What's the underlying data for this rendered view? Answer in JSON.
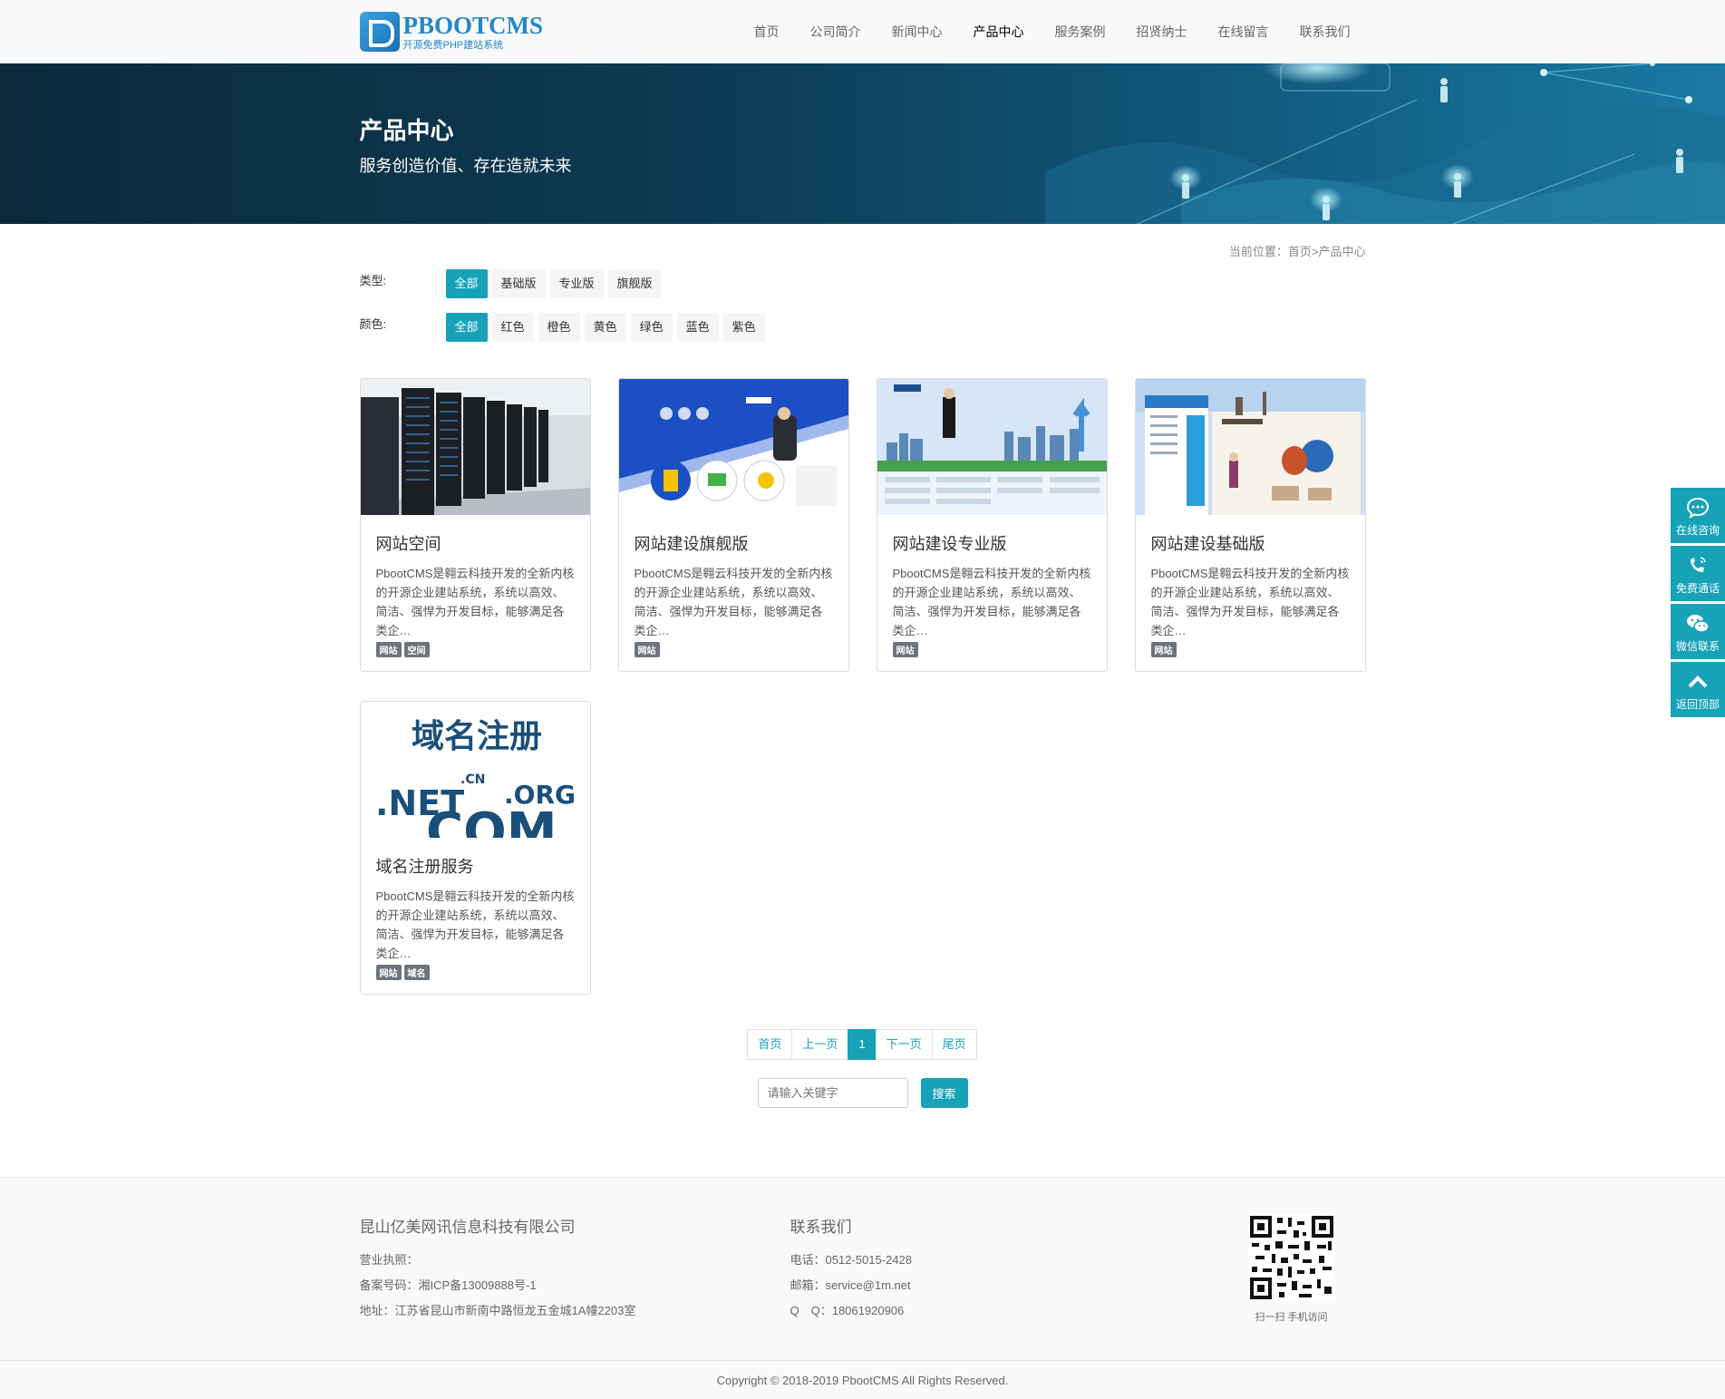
{
  "header": {
    "logo_name": "PBOOTCMS",
    "logo_sub": "开源免费PHP建站系统",
    "nav": [
      "首页",
      "公司简介",
      "新闻中心",
      "产品中心",
      "服务案例",
      "招贤纳士",
      "在线留言",
      "联系我们"
    ]
  },
  "banner": {
    "title": "产品中心",
    "subtitle": "服务创造价值、存在造就未来"
  },
  "breadcrumb": {
    "prefix": "当前位置：",
    "home": "首页",
    "sep": ">",
    "current": "产品中心"
  },
  "filters": {
    "type_label": "类型:",
    "type_opts": [
      "全部",
      "基础版",
      "专业版",
      "旗舰版"
    ],
    "color_label": "颜色:",
    "color_opts": [
      "全部",
      "红色",
      "橙色",
      "黄色",
      "绿色",
      "蓝色",
      "紫色"
    ]
  },
  "products": [
    {
      "title": "网站空间",
      "desc": "PbootCMS是翱云科技开发的全新内核的开源企业建站系统，系统以高效、简洁、强悍为开发目标，能够满足各类企…",
      "tags": [
        "网站",
        "空间"
      ],
      "thumb": "server-room"
    },
    {
      "title": "网站建设旗舰版",
      "desc": "PbootCMS是翱云科技开发的全新内核的开源企业建站系统，系统以高效、简洁、强悍为开发目标，能够满足各类企…",
      "tags": [
        "网站"
      ],
      "thumb": "blue-website"
    },
    {
      "title": "网站建设专业版",
      "desc": "PbootCMS是翱云科技开发的全新内核的开源企业建站系统，系统以高效、简洁、强悍为开发目标，能够满足各类企…",
      "tags": [
        "网站"
      ],
      "thumb": "asaweb-website"
    },
    {
      "title": "网站建设基础版",
      "desc": "PbootCMS是翱云科技开发的全新内核的开源企业建站系统，系统以高效、简洁、强悍为开发目标，能够满足各类企…",
      "tags": [
        "网站"
      ],
      "thumb": "tourshop-website"
    },
    {
      "title": "域名注册服务",
      "desc": "PbootCMS是翱云科技开发的全新内核的开源企业建站系统，系统以高效、简洁、强悍为开发目标，能够满足各类企…",
      "tags": [
        "网站",
        "域名"
      ],
      "thumb": "domain-register",
      "thumb_text": {
        "head": "域名注册",
        "net": ".NET",
        "cn": ".CN",
        "org": ".ORG",
        "com": "COM"
      }
    }
  ],
  "pager": {
    "first": "首页",
    "prev": "上一页",
    "current": "1",
    "next": "下一页",
    "last": "尾页"
  },
  "search": {
    "placeholder": "请输入关键字",
    "button": "搜索"
  },
  "footer": {
    "company": "昆山亿美网讯信息科技有限公司",
    "license": "营业执照：",
    "icp": "备案号码：湘ICP备13009888号-1",
    "address": "地址：江苏省昆山市新南中路恒龙五金城1A幢2203室",
    "contact_head": "联系我们",
    "phone": "电话：0512-5015-2428",
    "email": "邮箱：service@1m.net",
    "qq": "Q　Q：18061920906",
    "qr_caption": "扫一扫 手机访问",
    "copyright": "Copyright © 2018-2019 PbootCMS All Rights Reserved."
  },
  "side": [
    "在线咨询",
    "免费通话",
    "微信联系",
    "返回顶部"
  ],
  "colors": {
    "accent": "#17a2b8",
    "logo": "#2386c8",
    "banner_dark": "#0b2a3c"
  }
}
